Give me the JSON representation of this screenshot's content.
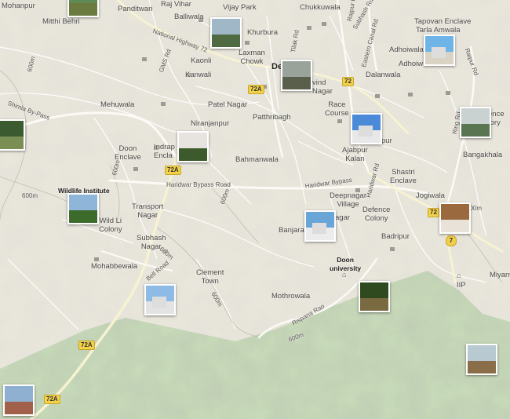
{
  "places": [
    {
      "id": "mohanpur",
      "text": "Mohanpur"
    },
    {
      "id": "mitthi-behri",
      "text": "Mitthi Behri"
    },
    {
      "id": "panditwari",
      "text": "Panditwari"
    },
    {
      "id": "raj-vihar",
      "text": "Raj Vihar"
    },
    {
      "id": "balliwala",
      "text": "Balliwala"
    },
    {
      "id": "vijay-park",
      "text": "Vijay Park"
    },
    {
      "id": "chukkuwala",
      "text": "Chukkuwala"
    },
    {
      "id": "khurbura",
      "text": "Khurbura"
    },
    {
      "id": "laxman-chowk",
      "text": "Laxman\nChowk"
    },
    {
      "id": "kaonli",
      "text": "Kaonli"
    },
    {
      "id": "kanwali",
      "text": "Kanwali"
    },
    {
      "id": "dehradun",
      "text": "De"
    },
    {
      "id": "arvind-nagar",
      "text": "vind\nNagar"
    },
    {
      "id": "tapovan-enclave",
      "text": "Tapovan Enclave"
    },
    {
      "id": "tarla-amwala",
      "text": "Tarla Amwala"
    },
    {
      "id": "adhoiwala-1",
      "text": "Adhoiwala"
    },
    {
      "id": "adhoiwala-2",
      "text": "Adhoiw"
    },
    {
      "id": "dalanwala",
      "text": "Dalanwala"
    },
    {
      "id": "mehuwala",
      "text": "Mehuwala"
    },
    {
      "id": "patel-nagar",
      "text": "Patel Nagar"
    },
    {
      "id": "niranjanpur",
      "text": "Niranjanpur"
    },
    {
      "id": "patthribagh",
      "text": "Patthribagh"
    },
    {
      "id": "race-course",
      "text": "Race\nCourse"
    },
    {
      "id": "doon-enclave",
      "text": "Doon\nEnclave"
    },
    {
      "id": "indrapuri-enclave",
      "text": "Indrap\nEncla"
    },
    {
      "id": "bahmanwala",
      "text": "Bahmanwala"
    },
    {
      "id": "ajabpur-kalan",
      "text": "Ajabpur\nKalan"
    },
    {
      "id": "shastri-enclave",
      "text": "Shastri\nEnclave"
    },
    {
      "id": "bangakhala",
      "text": "Bangakhala"
    },
    {
      "id": "ence-tory",
      "text": "ence\ntory"
    },
    {
      "id": "jogiwala",
      "text": "Jogiwala"
    },
    {
      "id": "wildlife-institute",
      "text": "Wildlife Institute"
    },
    {
      "id": "transport-nagar",
      "text": "Transport\nNagar"
    },
    {
      "id": "wild-life-colony",
      "text": "Wild Li\nColony"
    },
    {
      "id": "deepnagar-village",
      "text": "Deepnagar\nVillage"
    },
    {
      "id": "defence-colony",
      "text": "Defence\nColony"
    },
    {
      "id": "banjarawala",
      "text": "Banjara"
    },
    {
      "id": "agar",
      "text": "agar"
    },
    {
      "id": "badripur",
      "text": "Badripur"
    },
    {
      "id": "subhash-nagar",
      "text": "Subhash\nNagar"
    },
    {
      "id": "mohabbewala",
      "text": "Mohabbewala"
    },
    {
      "id": "clement-town",
      "text": "Clement\nTown"
    },
    {
      "id": "doon-university",
      "text": "Doon\nuniversity"
    },
    {
      "id": "mothrowala",
      "text": "Mothrowala"
    },
    {
      "id": "iip",
      "text": "IIP"
    },
    {
      "id": "miyanwala",
      "text": "Miyanw"
    },
    {
      "id": "pur",
      "text": "pur"
    }
  ],
  "roads": [
    {
      "id": "national-highway-72",
      "text": "National Highway 72"
    },
    {
      "id": "gms-rd",
      "text": "GMS Rd"
    },
    {
      "id": "tilak-rd",
      "text": "Tilak Rd"
    },
    {
      "id": "rajpur-rd",
      "text": "Rajpur Rd"
    },
    {
      "id": "subhash-rd",
      "text": "Subhash Rd"
    },
    {
      "id": "eastern-canal-rd",
      "text": "Eastern Canal Rd"
    },
    {
      "id": "raipur-rd",
      "text": "Raipur Rd"
    },
    {
      "id": "ring-rd",
      "text": "Ring Rd"
    },
    {
      "id": "shimla-bypass",
      "text": "Shimla By-Pass"
    },
    {
      "id": "haridwar-bypass-road-1",
      "text": "Haridwar Bypass Road"
    },
    {
      "id": "haridwar-bypass-road-2",
      "text": "Haridwar Bypass"
    },
    {
      "id": "haridwar-rd",
      "text": "Haridwar Rd"
    },
    {
      "id": "rispana-rao",
      "text": "Rispana Rao"
    },
    {
      "id": "bell-road",
      "text": "Bell Road"
    }
  ],
  "contours": [
    "600m",
    "600m",
    "600m",
    "600m",
    "600m",
    "600m",
    "600m",
    "600m"
  ],
  "shields": [
    {
      "id": "72-center",
      "text": "72A"
    },
    {
      "id": "72-east",
      "text": "72"
    },
    {
      "id": "72-se",
      "text": "72"
    },
    {
      "id": "72a-west",
      "text": "72A"
    },
    {
      "id": "72a-south",
      "text": "72A"
    },
    {
      "id": "72a-sw",
      "text": "72A"
    },
    {
      "id": "7-se",
      "text": "7"
    }
  ],
  "photos": [
    {
      "id": "photo-mohanpur",
      "sky": "#5f8a54",
      "ground": "#6b7a3f"
    },
    {
      "id": "photo-khurbura",
      "sky": "#9fb7c7",
      "ground": "#4f6a43"
    },
    {
      "id": "photo-dehradun-market",
      "sky": "#9aa39a",
      "ground": "#5a5f4c"
    },
    {
      "id": "photo-tapovan",
      "sky": "#6fb4e6",
      "ground": "#d9d3c4"
    },
    {
      "id": "photo-mehuwala-field",
      "sky": "#3b5a2f",
      "ground": "#7b8f55"
    },
    {
      "id": "photo-niranjanpur",
      "sky": "#e7e4df",
      "ground": "#3d5a2c"
    },
    {
      "id": "photo-ajabpur",
      "sky": "#4b89d9",
      "ground": "#e8e8e8"
    },
    {
      "id": "photo-hills",
      "sky": "#c9d1d1",
      "ground": "#5a7552"
    },
    {
      "id": "photo-wildlife",
      "sky": "#8fb5d9",
      "ground": "#3c6b2c"
    },
    {
      "id": "photo-banjarawala",
      "sky": "#6aa5d8",
      "ground": "#ececec"
    },
    {
      "id": "photo-jogiwala",
      "sky": "#9a6a3e",
      "ground": "#e8e2d8"
    },
    {
      "id": "photo-clement-town",
      "sky": "#8dbbe6",
      "ground": "#e3e3e3"
    },
    {
      "id": "photo-doon-univ",
      "sky": "#2e4a1e",
      "ground": "#7a6a42"
    },
    {
      "id": "photo-miyanwala",
      "sky": "#b8c9d2",
      "ground": "#8a6e4a"
    },
    {
      "id": "photo-sw",
      "sky": "#8fb0d0",
      "ground": "#a0604a"
    },
    {
      "id": "photo-field-west",
      "sky": "#c7d2da",
      "ground": "#4a6a34"
    }
  ]
}
